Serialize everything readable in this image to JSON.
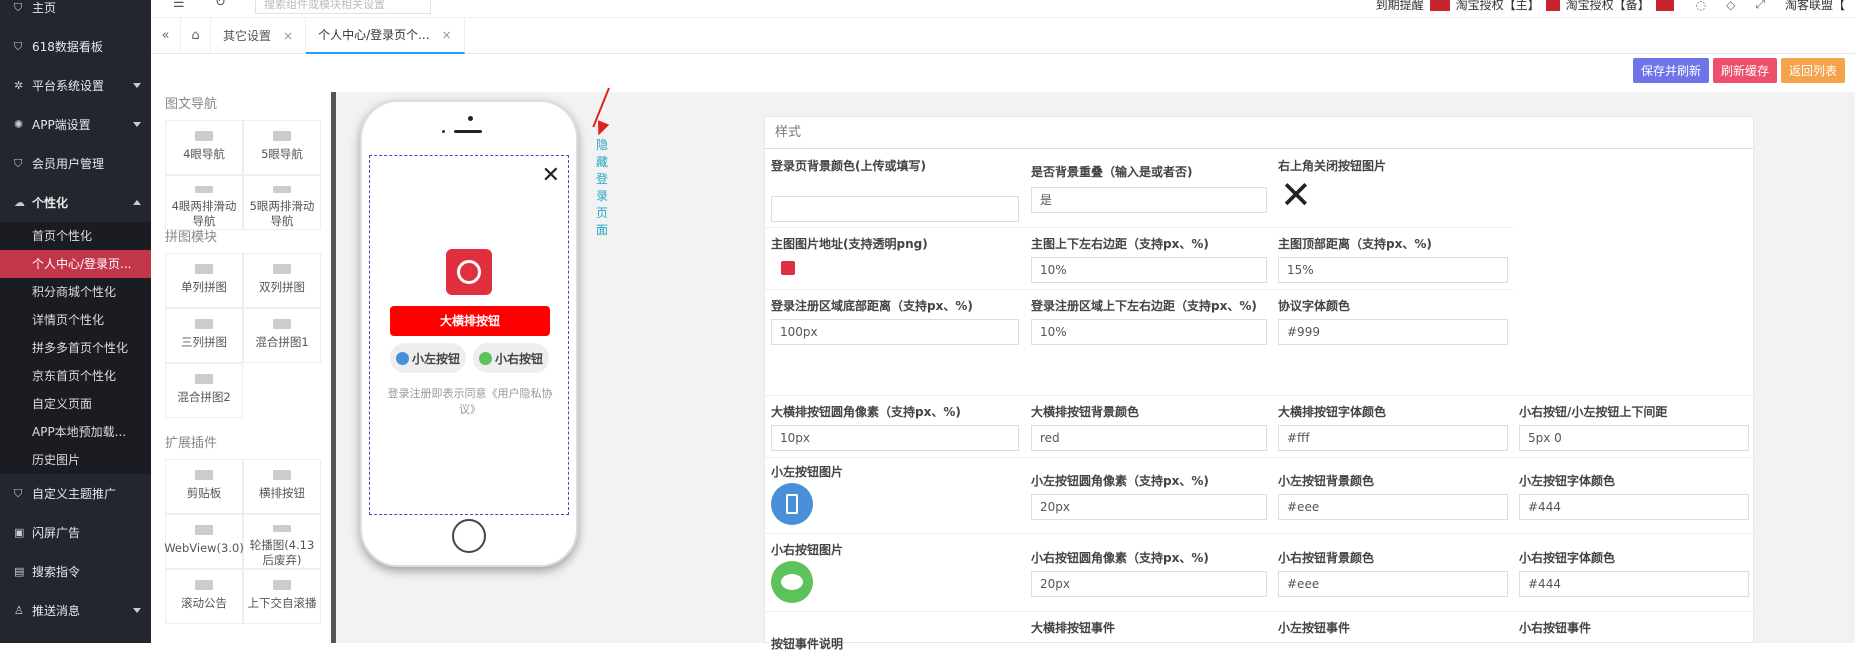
{
  "sidebar": {
    "items": [
      {
        "icon": "shield-icon",
        "label": "主页"
      },
      {
        "icon": "shield-icon",
        "label": "618数据看板"
      },
      {
        "icon": "wrench-icon",
        "label": "平台系统设置"
      },
      {
        "icon": "gear-icon",
        "label": "APP端设置"
      },
      {
        "icon": "shield-icon",
        "label": "会员用户管理"
      },
      {
        "icon": "palette-icon",
        "label": "个性化"
      }
    ],
    "sub_items": [
      "首页个性化",
      "个人中心/登录页...",
      "积分商城个性化",
      "详情页个性化",
      "拼多多首页个性化",
      "京东首页个性化",
      "自定义页面",
      "APP本地预加载...",
      "历史图片"
    ],
    "bottom_items": [
      {
        "icon": "shield-icon",
        "label": "自定义主题推广"
      },
      {
        "icon": "screen-icon",
        "label": "闪屏广告"
      },
      {
        "icon": "search-icon",
        "label": "搜索指令"
      },
      {
        "icon": "user-icon",
        "label": "推送消息"
      }
    ]
  },
  "topbar": {
    "search_placeholder": "搜索组件或模块相关设置",
    "expire_label": "到期提醒",
    "auth1": "淘宝授权【主】",
    "auth2": "淘宝授权【备】",
    "alliance": "淘客联盟【"
  },
  "tabs": {
    "items": [
      "其它设置",
      "个人中心/登录页个..."
    ]
  },
  "actions": {
    "save": "保存并刷新",
    "refresh": "刷新缓存",
    "back": "返回列表"
  },
  "widgets": {
    "nav_title": "图文导航",
    "nav_items": [
      "4眼导航",
      "5眼导航",
      "4眼两排滑动导航",
      "5眼两排滑动导航"
    ],
    "puzzle_title": "拼图模块",
    "puzzle_items": [
      "单列拼图",
      "双列拼图",
      "三列拼图",
      "混合拼图1",
      "混合拼图2"
    ],
    "plugin_title": "扩展插件",
    "plugin_items": [
      "剪贴板",
      "横排按钮",
      "WebView(3.0)",
      "轮播图(4.13后废弃)",
      "滚动公告",
      "上下交自滚播"
    ]
  },
  "preview": {
    "hide_label": "隐藏登录页面",
    "main_button": "大横排按钮",
    "left_button": "小左按钮",
    "right_button": "小右按钮",
    "agreement": "登录注册即表示同意《用户隐私协议》"
  },
  "form": {
    "title": "样式",
    "row1": {
      "bg_color_label": "登录页背景颜色(上传或填写)",
      "bg_color_value": "",
      "bg_repeat_label": "是否背景重叠（输入是或者否)",
      "bg_repeat_value": "是",
      "close_img_label": "右上角关闭按钮图片"
    },
    "row2": {
      "main_img_label": "主图图片地址(支持透明png)",
      "main_margin_label": "主图上下左右边距（支持px、%)",
      "main_margin_value": "10%",
      "main_top_label": "主图顶部距离（支持px、%)",
      "main_top_value": "15%"
    },
    "row3": {
      "area_bottom_label": "登录注册区域底部距离（支持px、%)",
      "area_bottom_value": "100px",
      "area_margin_label": "登录注册区域上下左右边距（支持px、%)",
      "area_margin_value": "10%",
      "agree_color_label": "协议字体颜色",
      "agree_color_value": "#999"
    },
    "row4": {
      "radius_label": "大横排按钮圆角像素（支持px、%)",
      "radius_value": "10px",
      "bg_label": "大横排按钮背景颜色",
      "bg_value": "red",
      "font_label": "大横排按钮字体颜色",
      "font_value": "#fff",
      "gap_label": "小右按钮/小左按钮上下间距",
      "gap_value": "5px 0"
    },
    "row5": {
      "img_label": "小左按钮图片",
      "radius_label": "小左按钮圆角像素（支持px、%)",
      "radius_value": "20px",
      "bg_label": "小左按钮背景颜色",
      "bg_value": "#eee",
      "font_label": "小左按钮字体颜色",
      "font_value": "#444"
    },
    "row6": {
      "img_label": "小右按钮图片",
      "radius_label": "小右按钮圆角像素（支持px、%)",
      "radius_value": "20px",
      "bg_label": "小右按钮背景颜色",
      "bg_value": "#eee",
      "font_label": "小右按钮字体颜色",
      "font_value": "#444"
    },
    "row7": {
      "desc_label": "按钮事件说明",
      "main_event_label": "大横排按钮事件",
      "left_event_label": "小左按钮事件",
      "right_event_label": "小右按钮事件"
    }
  },
  "colors": {
    "sidebar_bg": "#23262e",
    "active": "#c2364a",
    "save_btn": "#6e74e8",
    "refresh_btn": "#ee4f6a",
    "back_btn": "#f5a34a",
    "main_button": "#ff0000"
  }
}
